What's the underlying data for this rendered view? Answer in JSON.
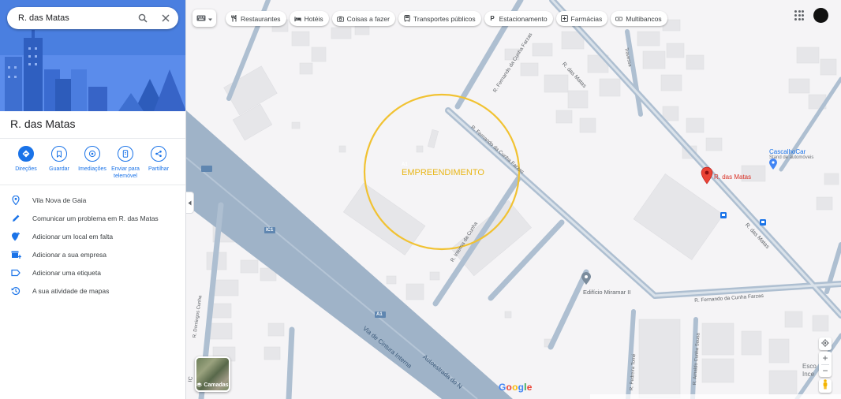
{
  "search": {
    "value": "R. das Matas"
  },
  "place": {
    "title": "R. das Matas",
    "actions": [
      {
        "label": "Direções",
        "icon": "directions-icon"
      },
      {
        "label": "Guardar",
        "icon": "bookmark-icon"
      },
      {
        "label": "Imediações",
        "icon": "nearby-icon"
      },
      {
        "label": "Enviar para telemóvel",
        "icon": "send-to-phone-icon"
      },
      {
        "label": "Partilhar",
        "icon": "share-icon"
      }
    ],
    "rows": [
      {
        "label": "Vila Nova de Gaia",
        "icon": "location-pin-icon"
      },
      {
        "label": "Comunicar um problema em R. das Matas",
        "icon": "pencil-icon"
      },
      {
        "label": "Adicionar um local em falta",
        "icon": "add-place-icon"
      },
      {
        "label": "Adicionar a sua empresa",
        "icon": "add-business-icon"
      },
      {
        "label": "Adicionar uma etiqueta",
        "icon": "label-icon"
      },
      {
        "label": "A sua atividade de mapas",
        "icon": "history-icon"
      }
    ]
  },
  "chips": [
    {
      "label": "Restaurantes",
      "icon": "restaurant-icon"
    },
    {
      "label": "Hotéis",
      "icon": "hotel-icon"
    },
    {
      "label": "Coisas a fazer",
      "icon": "camera-icon"
    },
    {
      "label": "Transportes públicos",
      "icon": "transit-icon"
    },
    {
      "label": "Estacionamento",
      "icon": "parking-icon"
    },
    {
      "label": "Farmácias",
      "icon": "pharmacy-icon"
    },
    {
      "label": "Multibancos",
      "icon": "atm-icon"
    }
  ],
  "map": {
    "annotation": "EMPREENDIMENTO",
    "annotation_color": "#f1c232",
    "pin_label": "R. das Matas",
    "pin_color": "#ea4335",
    "poi": [
      {
        "name": "CascalhoCar",
        "subtitle": "Stand de automóveis"
      },
      {
        "name": "Edifício Miramar II"
      }
    ],
    "streets": [
      "R. das Matas",
      "R. das Matas",
      "R. Fernando da Cunha Farzas",
      "R. Fernando da Cunha Farzas",
      "R. Fernando da Cunha Farzas",
      "Via de Cintura Interna",
      "Autoestrada do N",
      "R. Interna da Cunha",
      "R. Domingos Cunha",
      "R. Arnaldo Cunha Sousa",
      "R. Pedreira Tomé",
      "Travessa"
    ],
    "road_shields": [
      "A1",
      "IC1",
      "A1"
    ],
    "partial_labels": [
      "Esco",
      "Ince",
      "IC"
    ],
    "layers_label": "Camadas",
    "logo": "Google",
    "colors": {
      "background": "#f5f4f6",
      "highway": "#9fb3c8",
      "road": "#aebfd1",
      "building": "#e8e8ea",
      "sidebar_hero": "#4a7fe0",
      "accent": "#1a73e8"
    }
  }
}
